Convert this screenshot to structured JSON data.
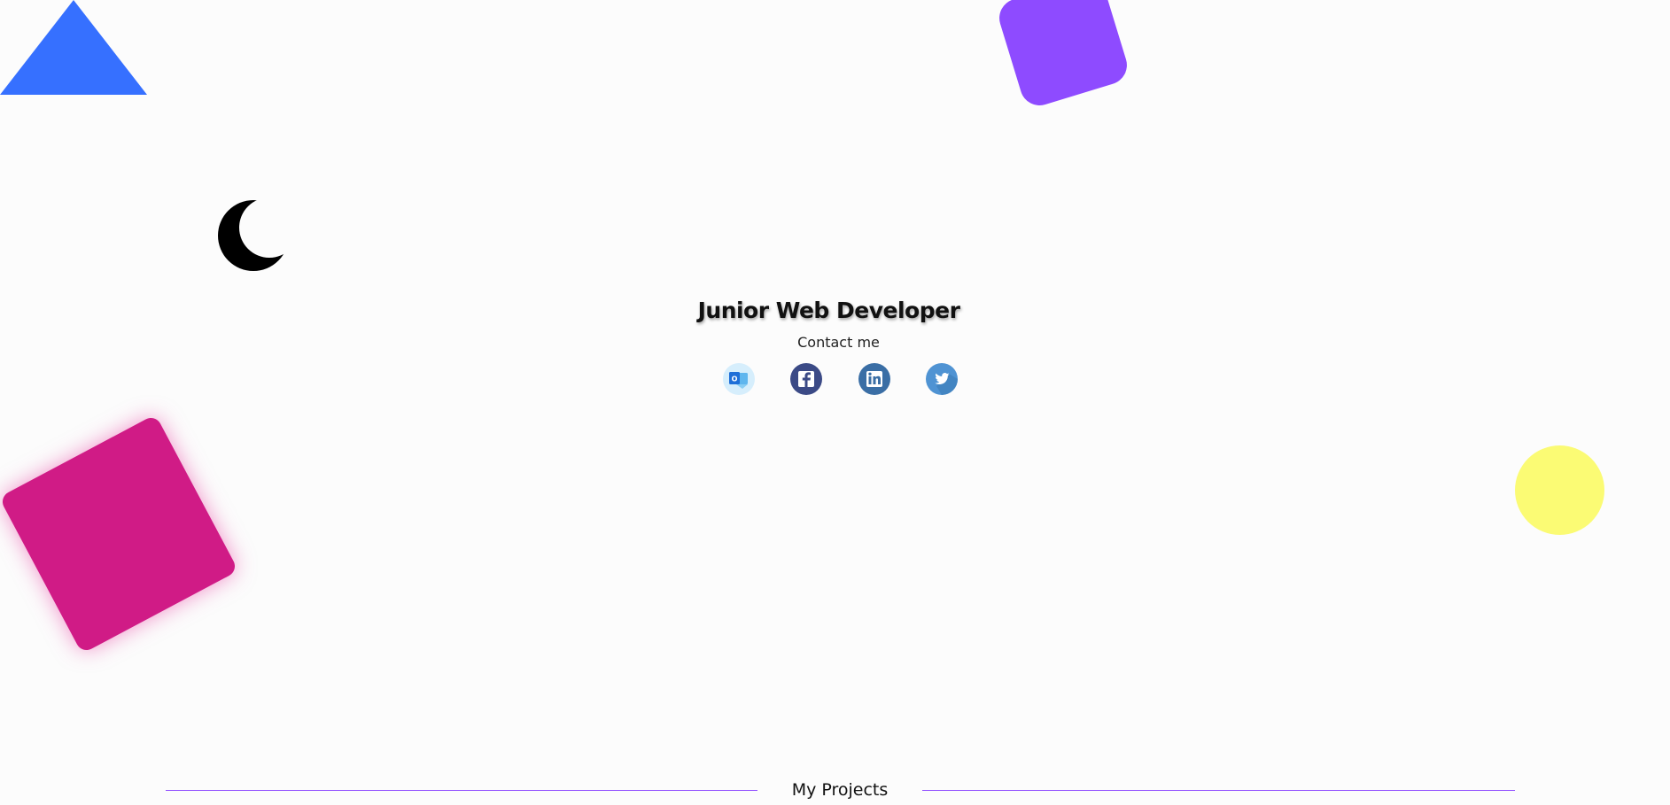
{
  "hero": {
    "title": "Junior Web Developer",
    "contact_label": "Contact me"
  },
  "socials": [
    {
      "name": "outlook",
      "icon": "outlook-icon",
      "color": "#1e6fd8"
    },
    {
      "name": "facebook",
      "icon": "facebook-icon",
      "color": "#3b4a86"
    },
    {
      "name": "linkedin",
      "icon": "linkedin-icon",
      "color": "#3a6ea5"
    },
    {
      "name": "twitter",
      "icon": "twitter-icon",
      "color": "#4f93d3"
    }
  ],
  "theme_toggle": {
    "icon": "moon-icon"
  },
  "projects": {
    "heading": "My Projects"
  },
  "colors": {
    "background": "#fcfcfc",
    "triangle": "#3670ff",
    "purple_square": "#8e4bff",
    "pink_square": "#d01b86",
    "yellow_circle": "#fbfb74",
    "divider": "#8e4bff"
  }
}
